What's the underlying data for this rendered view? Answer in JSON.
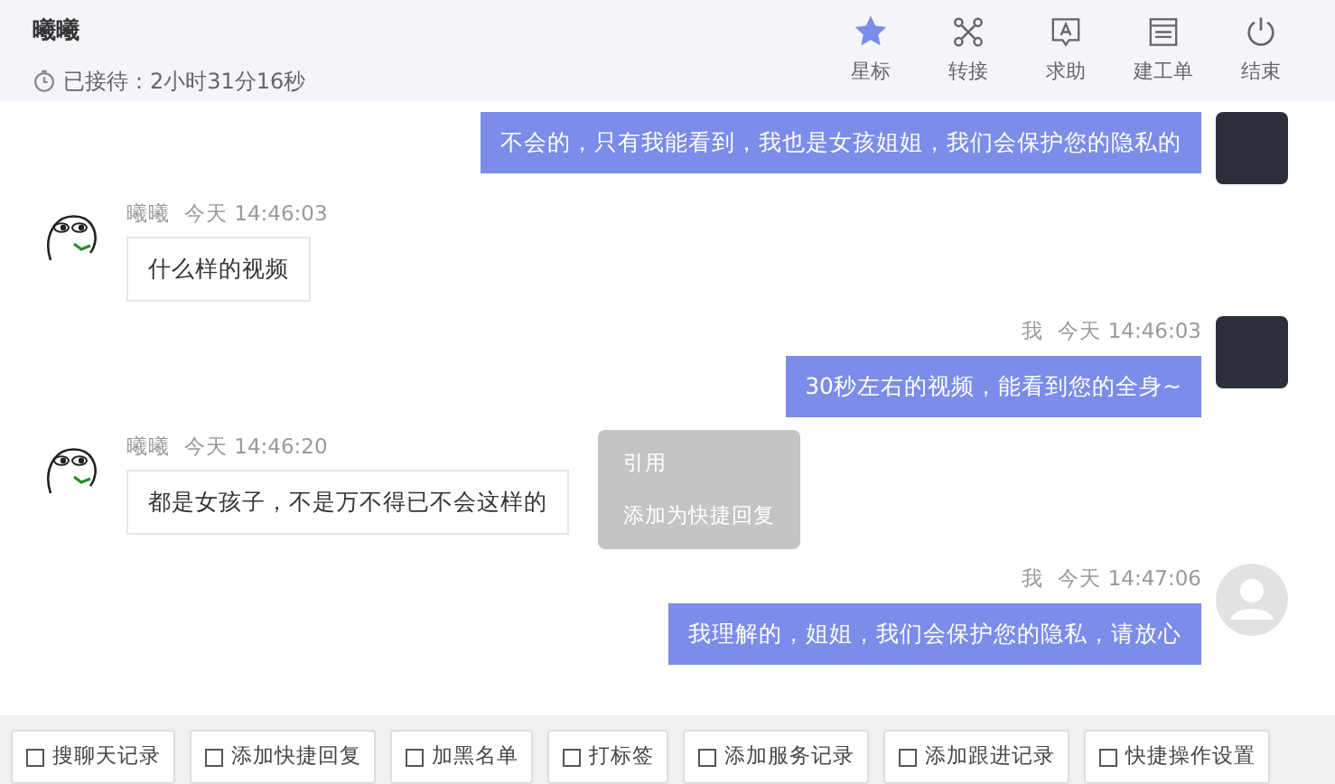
{
  "header": {
    "name": "曦曦",
    "wait_label": "已接待：2小时31分16秒",
    "actions": [
      {
        "kind": "star",
        "label": "星标",
        "on": true
      },
      {
        "kind": "transfer",
        "label": "转接",
        "on": false
      },
      {
        "kind": "help",
        "label": "求助",
        "on": false
      },
      {
        "kind": "ticket",
        "label": "建工单",
        "on": false
      },
      {
        "kind": "end",
        "label": "结束",
        "on": false
      }
    ]
  },
  "messages": [
    {
      "kind": "outgoing",
      "avatar": {
        "kind": "photo"
      },
      "text": "不会的，只有我能看到，我也是女孩姐姐，我们会保护您的隐私的"
    },
    {
      "kind": "incoming",
      "avatar": {
        "kind": "cartoon"
      },
      "sender": "曦曦",
      "time": "今天 14:46:03",
      "text": "什么样的视频"
    },
    {
      "kind": "outgoing",
      "avatar": {
        "kind": "photo"
      },
      "sender": "我",
      "time": "今天 14:46:03",
      "text": "30秒左右的视频，能看到您的全身~"
    },
    {
      "kind": "incoming",
      "avatar": {
        "kind": "cartoon"
      },
      "sender": "曦曦",
      "time": "今天 14:46:20",
      "text": "都是女孩子，不是万不得已不会这样的",
      "menu": [
        "引用",
        "添加为快捷回复"
      ]
    },
    {
      "kind": "outgoing",
      "avatar": {
        "kind": "default"
      },
      "sender": "我",
      "time": "今天 14:47:06",
      "text": "我理解的，姐姐，我们会保护您的隐私，请放心"
    }
  ],
  "toolbar": [
    "搜聊天记录",
    "添加快捷回复",
    "加黑名单",
    "打标签",
    "添加服务记录",
    "添加跟进记录",
    "快捷操作设置"
  ]
}
